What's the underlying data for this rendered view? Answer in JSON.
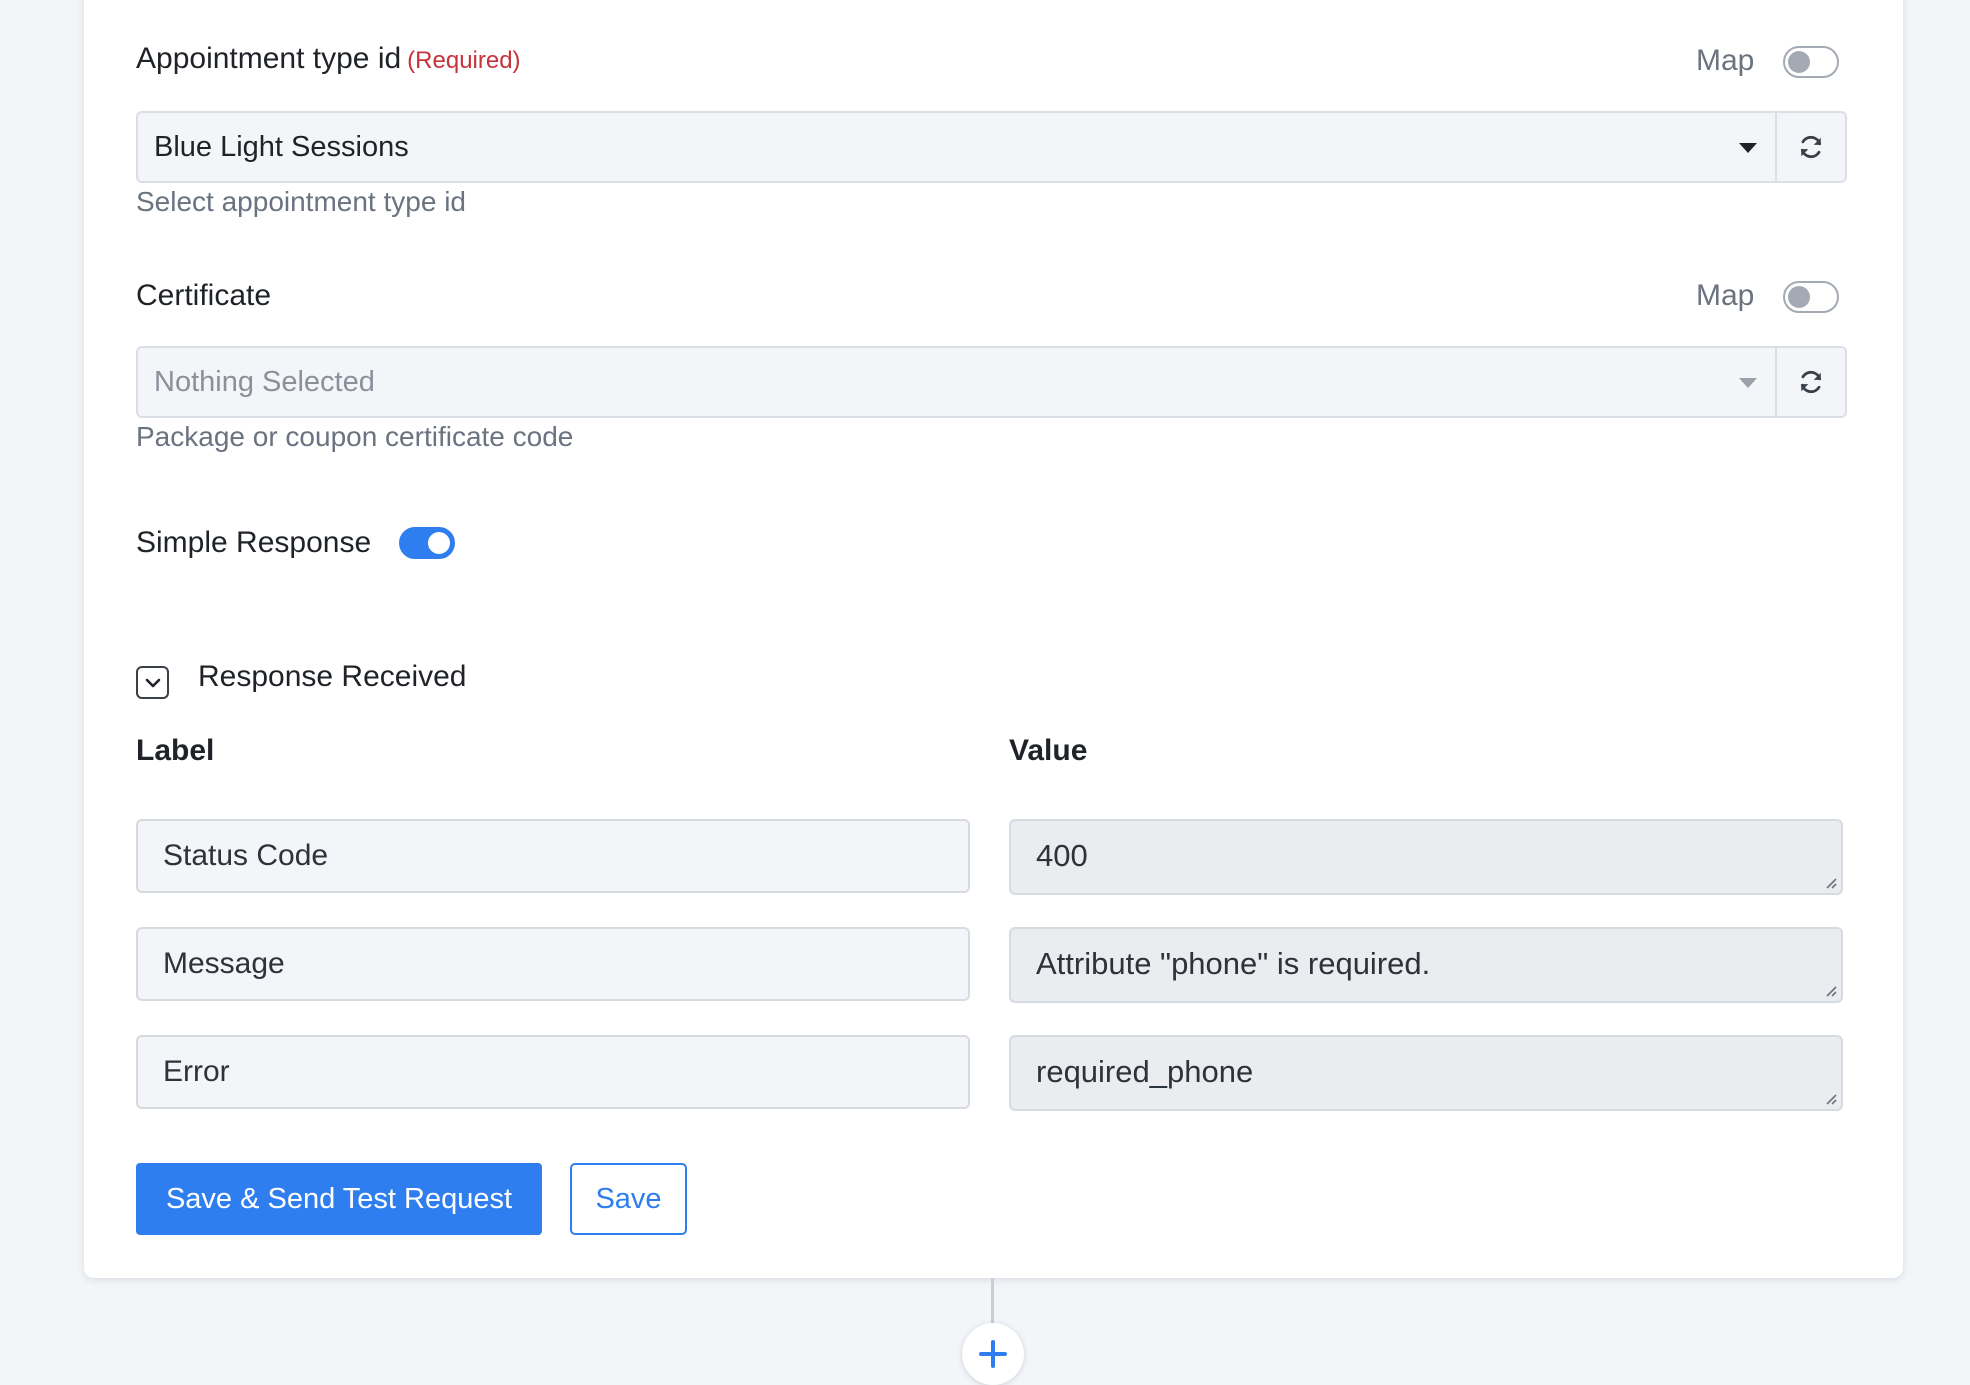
{
  "appointment_type": {
    "label": "Appointment type id",
    "required_text": "(Required)",
    "map_label": "Map",
    "map_enabled": false,
    "selected_value": "Blue Light Sessions",
    "helper": "Select appointment type id"
  },
  "certificate": {
    "label": "Certificate",
    "map_label": "Map",
    "map_enabled": false,
    "placeholder": "Nothing Selected",
    "helper": "Package or coupon certificate code"
  },
  "simple_response": {
    "label": "Simple Response",
    "enabled": true
  },
  "response_received": {
    "title": "Response Received",
    "expanded": true,
    "label_header": "Label",
    "value_header": "Value",
    "rows": [
      {
        "label": "Status Code",
        "value": "400"
      },
      {
        "label": "Message",
        "value": "Attribute \"phone\" is required."
      },
      {
        "label": "Error",
        "value": "required_phone"
      }
    ]
  },
  "actions": {
    "save_and_test_label": "Save & Send Test Request",
    "save_label": "Save"
  },
  "icons": {
    "refresh": "refresh-icon",
    "caret": "caret-down-icon",
    "chevron": "chevron-down-icon",
    "add": "plus-icon"
  },
  "colors": {
    "accent": "#2f7ef0",
    "required": "#c6333c",
    "page_background": "#f3f6f9"
  }
}
